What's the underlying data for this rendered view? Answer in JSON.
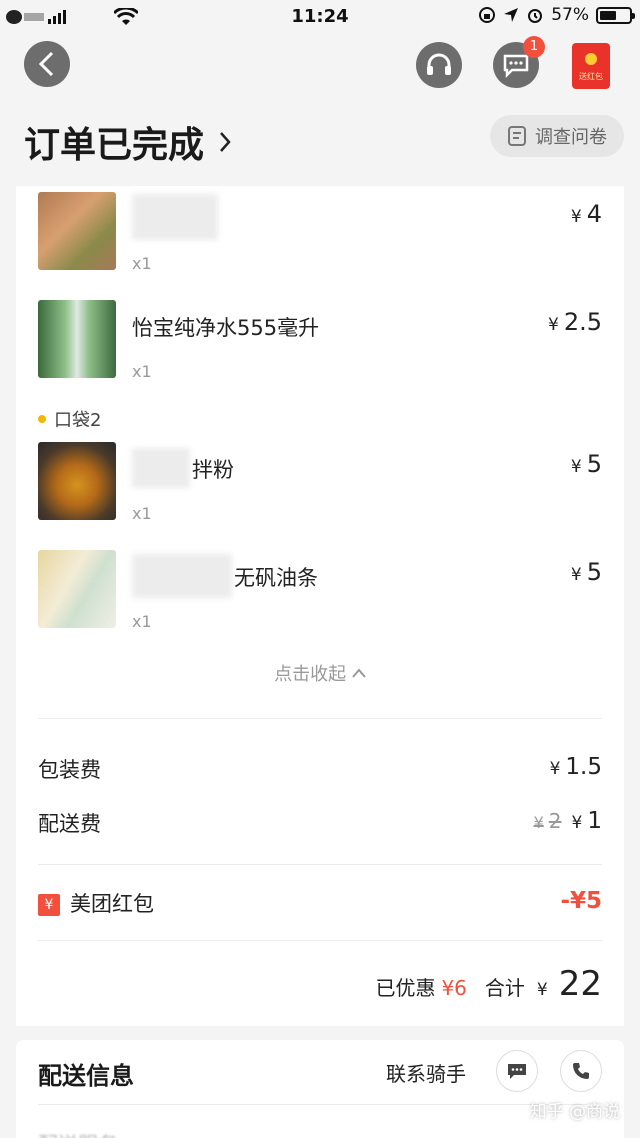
{
  "status_bar": {
    "time": "11:24",
    "battery": "57%",
    "battery_level": 0.57
  },
  "header": {
    "message_badge": "1",
    "red_packet_label": "送红包",
    "order_status": "订单已完成",
    "survey_label": "调查问卷"
  },
  "items": [
    {
      "name": "",
      "qty": "x1",
      "price_symbol": "¥",
      "price": "4"
    },
    {
      "name": "怡宝纯净水555毫升",
      "qty": "x1",
      "price_symbol": "¥",
      "price": "2.5"
    },
    {
      "name": "拌粉",
      "qty": "x1",
      "price_symbol": "¥",
      "price": "5"
    },
    {
      "name": "无矾油条",
      "qty": "x1",
      "price_symbol": "¥",
      "price": "5"
    }
  ],
  "bag2_label": "口袋2",
  "collapse_label": "点击收起",
  "fees": {
    "packaging_label": "包装费",
    "packaging_value": "1.5",
    "delivery_label": "配送费",
    "delivery_original": "2",
    "delivery_value": "1",
    "currency": "¥"
  },
  "discount": {
    "icon": "¥",
    "label": "美团红包",
    "value": "-¥5"
  },
  "total": {
    "saved_label": "已优惠",
    "saved_value": "¥6",
    "total_label": "合计",
    "currency": "¥",
    "total_value": "22"
  },
  "delivery": {
    "title": "配送信息",
    "contact_label": "联系骑手",
    "cut_text": "配送服务"
  },
  "watermark": "知乎 @商说",
  "colors": {
    "accent_red": "#f2503c",
    "dark_button": "#6d6d6d"
  }
}
